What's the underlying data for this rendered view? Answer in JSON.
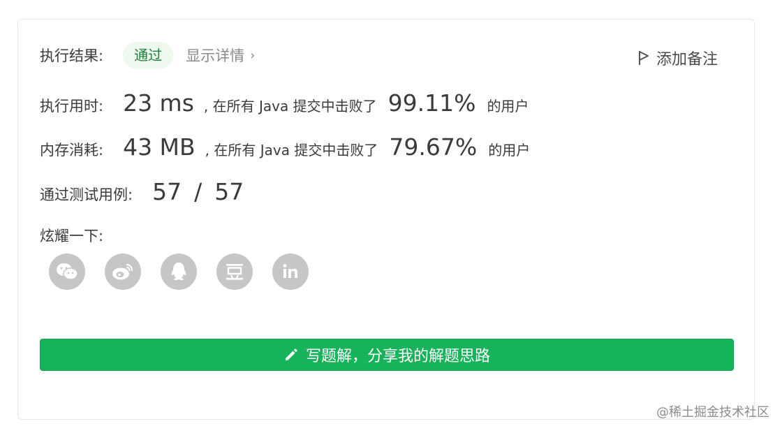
{
  "result": {
    "label": "执行结果:",
    "status": "通过",
    "detail_link": "显示详情",
    "detail_chevron": "›",
    "add_note": "添加备注"
  },
  "runtime": {
    "label": "执行用时:",
    "value": "23 ms",
    "mid_text": ", 在所有 Java 提交中击败了",
    "percent": "99.11%",
    "suffix": "的用户"
  },
  "memory": {
    "label": "内存消耗:",
    "value": "43 MB",
    "mid_text": ", 在所有 Java 提交中击败了",
    "percent": "79.67%",
    "suffix": "的用户"
  },
  "tests": {
    "label": "通过测试用例:",
    "passed": "57",
    "separator": "/",
    "total": "57"
  },
  "share": {
    "label": "炫耀一下:",
    "icons": [
      "wechat-icon",
      "weibo-icon",
      "qq-icon",
      "douban-icon",
      "linkedin-icon"
    ]
  },
  "write_button": {
    "label": "写题解，分享我的解题思路"
  },
  "watermark": "@稀土掘金技术社区",
  "colors": {
    "accent_green": "#17b35a",
    "status_green": "#1a7f37",
    "icon_gray": "#c6c6c6"
  }
}
